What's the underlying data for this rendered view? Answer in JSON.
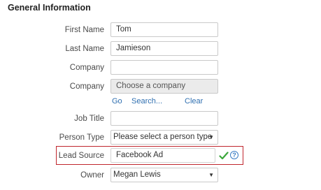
{
  "section": {
    "title": "General Information"
  },
  "fields": {
    "first_name": {
      "label": "First Name",
      "value": "Tom"
    },
    "last_name": {
      "label": "Last Name",
      "value": "Jamieson"
    },
    "company_text": {
      "label": "Company",
      "value": ""
    },
    "company_choose": {
      "label": "Company",
      "value": "Choose a company"
    },
    "job_title": {
      "label": "Job Title",
      "value": ""
    },
    "person_type": {
      "label": "Person Type",
      "value": "Please select a person type"
    },
    "lead_source": {
      "label": "Lead Source",
      "value": "Facebook Ad"
    },
    "owner": {
      "label": "Owner",
      "value": "Megan Lewis"
    }
  },
  "company_links": {
    "go": "Go",
    "search": "Search...",
    "clear": "Clear"
  },
  "icons": {
    "check": "check-icon",
    "help": "help-icon",
    "caret": "chevron-down-icon"
  },
  "colors": {
    "highlight_border": "#c0262d",
    "link": "#2f6fb0",
    "check": "#3aa63a",
    "help": "#3a7cc4"
  }
}
